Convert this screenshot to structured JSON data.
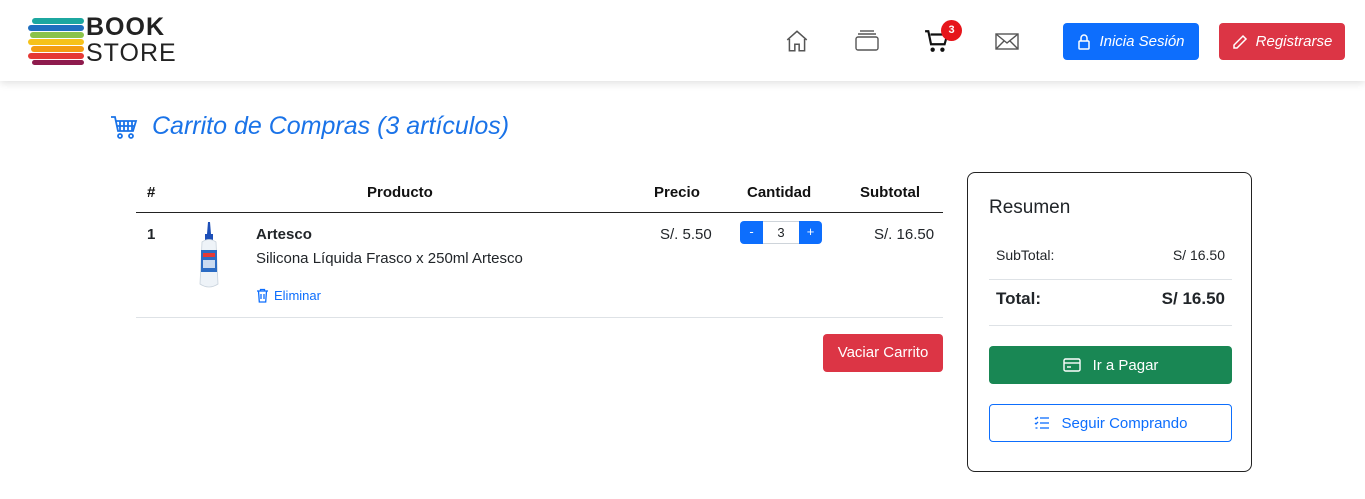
{
  "brand": {
    "line1": "BOOK",
    "line2": "STORE"
  },
  "nav": {
    "icons": [
      "home-icon",
      "layers-icon",
      "cart-icon",
      "mail-icon"
    ],
    "cart_badge": "3",
    "login_label": "Inicia Sesión",
    "register_label": "Registrarse"
  },
  "page": {
    "title": "Carrito de Compras (3 artículos)"
  },
  "table": {
    "headers": {
      "num": "#",
      "product": "Producto",
      "price": "Precio",
      "qty": "Cantidad",
      "subtotal": "Subtotal"
    },
    "rows": [
      {
        "num": "1",
        "brand": "Artesco",
        "name": "Silicona Líquida Frasco x 250ml Artesco",
        "price": "S/. 5.50",
        "qty": "3",
        "qty_minus": "-",
        "qty_plus": "+",
        "subtotal": "S/. 16.50",
        "remove_label": "Eliminar"
      }
    ]
  },
  "clear_cart_label": "Vaciar Carrito",
  "summary": {
    "title": "Resumen",
    "subtotal_label": "SubTotal:",
    "subtotal_value": "S/ 16.50",
    "total_label": "Total:",
    "total_value": "S/ 16.50",
    "pay_label": "Ir a Pagar",
    "continue_label": "Seguir Comprando"
  },
  "colors": {
    "primary": "#0d6efd",
    "danger": "#dc3545",
    "success": "#198754",
    "title": "#1a73e8"
  }
}
